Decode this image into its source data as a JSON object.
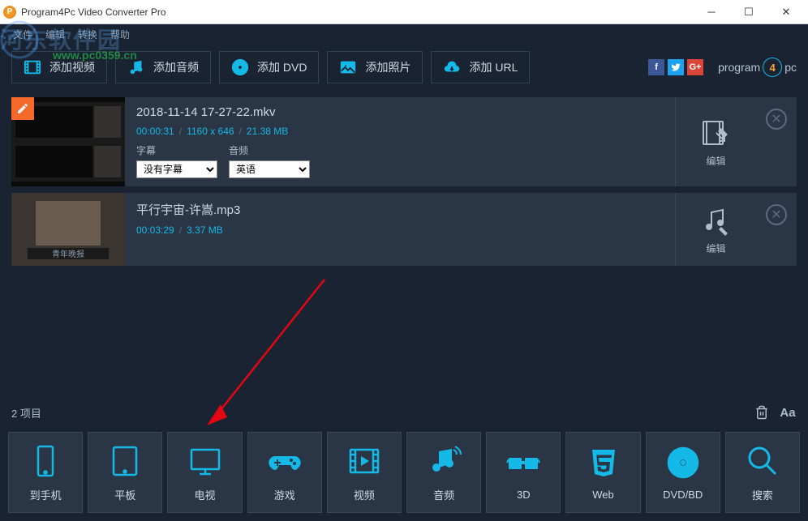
{
  "window": {
    "title": "Program4Pc Video Converter Pro"
  },
  "menu": {
    "file": "文件",
    "edit": "编辑",
    "convert": "转换",
    "help": "帮助"
  },
  "watermark": {
    "text": "河东软件园",
    "url": "www.pc0359.cn"
  },
  "toolbar": {
    "add_video": "添加视频",
    "add_audio": "添加音频",
    "add_dvd": "添加 DVD",
    "add_photo": "添加照片",
    "add_url": "添加 URL"
  },
  "brand": {
    "prefix": "program",
    "number": "4",
    "suffix": "pc"
  },
  "files": [
    {
      "title": "2018-11-14 17-27-22.mkv",
      "duration": "00:00:31",
      "dimensions": "1160 x 646",
      "size": "21.38 MB",
      "subtitle_label": "字幕",
      "subtitle_value": "没有字幕",
      "audio_label": "音频",
      "audio_value": "英语",
      "edit": "编辑"
    },
    {
      "title": "平行宇宙-许嵩.mp3",
      "duration": "00:03:29",
      "size": "3.37 MB",
      "edit": "编辑"
    }
  ],
  "status": {
    "count": "2 项目"
  },
  "tabs": {
    "phone": "到手机",
    "tablet": "平板",
    "tv": "电视",
    "game": "游戏",
    "video": "视频",
    "audio": "音频",
    "threed": "3D",
    "web": "Web",
    "dvd": "DVD/BD",
    "search": "搜索"
  }
}
